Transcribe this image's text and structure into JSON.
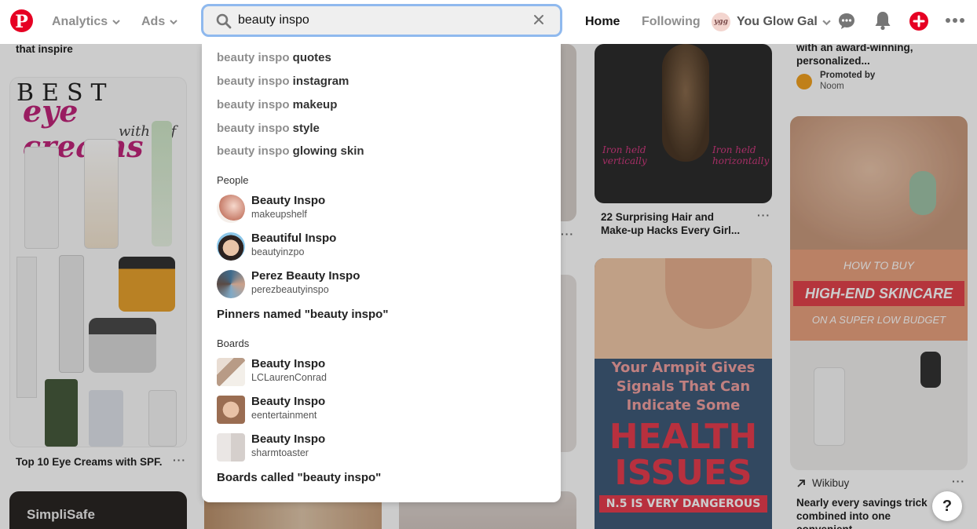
{
  "header": {
    "analytics_label": "Analytics",
    "ads_label": "Ads",
    "search_value": "beauty inspo",
    "nav_home": "Home",
    "nav_following": "Following",
    "profile_name": "You Glow Gal",
    "profile_initials": "ygg",
    "brand_color": "#e60023"
  },
  "dropdown": {
    "query": "beauty inspo",
    "suggestions": [
      {
        "rest": " quotes"
      },
      {
        "rest": " instagram"
      },
      {
        "rest": " makeup"
      },
      {
        "rest": " style"
      },
      {
        "rest": " glowing skin"
      }
    ],
    "people_label": "People",
    "people": [
      {
        "name": "Beauty Inspo",
        "handle": "makeupshelf"
      },
      {
        "name": "Beautiful Inspo",
        "handle": "beautyinzpo"
      },
      {
        "name": "Perez Beauty Inspo",
        "handle": "perezbeautyinspo"
      }
    ],
    "pinners_link": "Pinners named \"beauty inspo\"",
    "boards_label": "Boards",
    "boards": [
      {
        "name": "Beauty Inspo",
        "owner": "LCLaurenConrad"
      },
      {
        "name": "Beauty Inspo",
        "owner": "eentertainment"
      },
      {
        "name": "Beauty Inspo",
        "owner": "sharmtoaster"
      }
    ],
    "boards_link": "Boards called \"beauty inspo\""
  },
  "pins": {
    "col1_top_title": "that inspire",
    "eye_creams_best": "BEST",
    "eye_creams_script": "eye creams",
    "eye_creams_spf": "with spf",
    "eye_creams_title": "Top 10 Eye Creams with SPF.",
    "simplisafe": "SimpliSafe",
    "hair_left_text": "Iron held vertically",
    "hair_right_text": "Iron held horizontally",
    "hair_title": "22 Surprising Hair and Make-up Hacks Every Girl...",
    "armpit_text": "Your Armpit Gives Signals That Can Indicate Some",
    "health": "HEALTH",
    "issues": "ISSUES",
    "dangerous": "N.5 IS VERY DANGEROUS",
    "col5_top_title": "with an award-winning, personalized...",
    "promoted_by": "Promoted by",
    "promoter": "Noom",
    "skincare_how": "HOW TO BUY",
    "skincare_main": "HIGH-END SKINCARE",
    "skincare_budget": "ON A SUPER LOW BUDGET",
    "wikibuy": "Wikibuy",
    "wikibuy_title": "Nearly every savings trick combined into one convenient...",
    "more": "···"
  },
  "help_label": "?"
}
